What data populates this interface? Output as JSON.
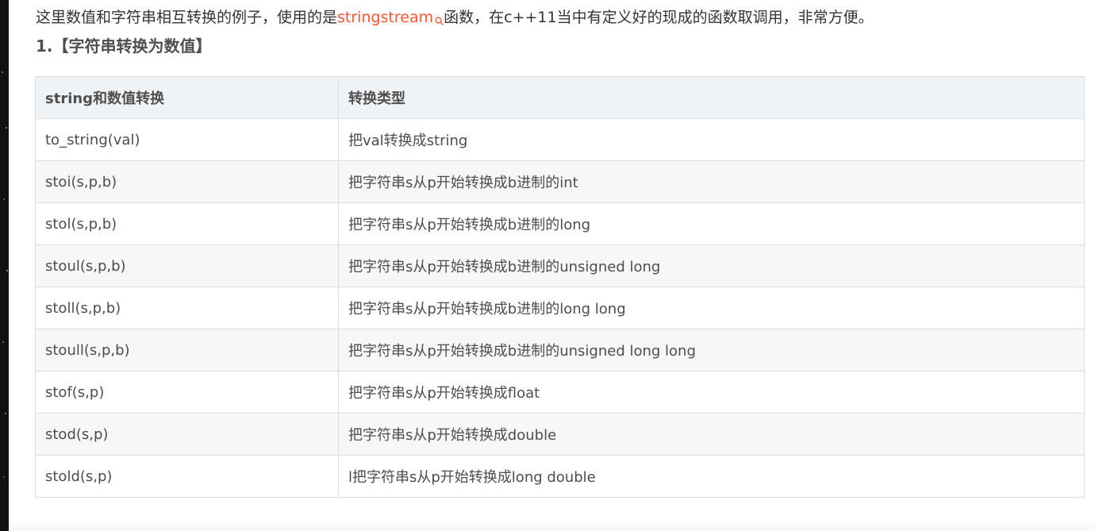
{
  "intro": {
    "before_link": "这里数值和字符串相互转换的例子，使用的是",
    "link_text": "stringstream",
    "after_link": "函数，在c++11当中有定义好的现成的函数取调用，非常方便。"
  },
  "heading": "1.【字符串转换为数值】",
  "table": {
    "headers": [
      "string和数值转换",
      "转换类型"
    ],
    "rows": [
      [
        "to_string(val)",
        "把val转换成string"
      ],
      [
        "stoi(s,p,b)",
        "把字符串s从p开始转换成b进制的int"
      ],
      [
        "stol(s,p,b)",
        "把字符串s从p开始转换成b进制的long"
      ],
      [
        "stoul(s,p,b)",
        "把字符串s从p开始转换成b进制的unsigned long"
      ],
      [
        "stoll(s,p,b)",
        "把字符串s从p开始转换成b进制的long long"
      ],
      [
        "stoull(s,p,b)",
        "把字符串s从p开始转换成b进制的unsigned long long"
      ],
      [
        "stof(s,p)",
        "把字符串s从p开始转换成float"
      ],
      [
        "stod(s,p)",
        "把字符串s从p开始转换成double"
      ],
      [
        "stold(s,p)",
        "l把字符串s从p开始转换成long double"
      ]
    ]
  },
  "icons": {
    "link_search": "search-icon"
  },
  "colors": {
    "link": "#fc5531",
    "header_bg": "#eff3f5",
    "stripe_bg": "#f7f7f8",
    "border": "#dddddd"
  }
}
